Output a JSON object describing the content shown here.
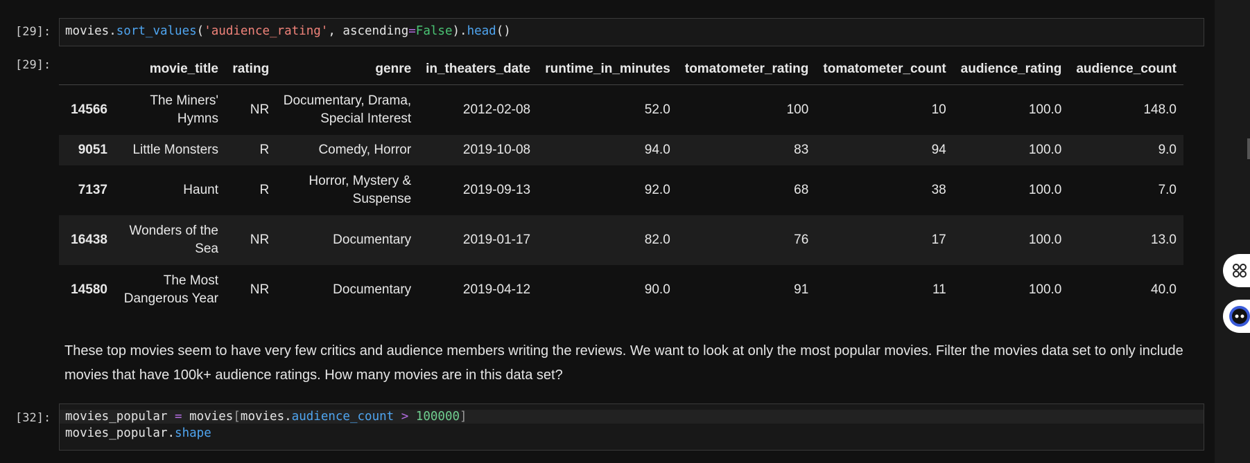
{
  "cells": {
    "c1": {
      "in_prompt": "[29]:",
      "out_prompt": "[29]:"
    },
    "c2": {
      "in_prompt": "[32]:"
    }
  },
  "code1": {
    "t1": "movies",
    "t2": ".",
    "t3": "sort_values",
    "t4": "(",
    "t5": "'audience_rating'",
    "t6": ", ascending",
    "t7": "=",
    "t8": "False",
    "t9": ").",
    "t10": "head",
    "t11": "()"
  },
  "code2": {
    "l1": {
      "t1": "movies_popular ",
      "t2": "=",
      "t3": " movies",
      "t4": "[",
      "t5": "movies.",
      "t6": "audience_count",
      "t7": " > ",
      "t8": "100000",
      "t9": "]"
    },
    "l2": {
      "t1": "movies_popular.",
      "t2": "shape"
    }
  },
  "table": {
    "columns": [
      "",
      "movie_title",
      "rating",
      "genre",
      "in_theaters_date",
      "runtime_in_minutes",
      "tomatometer_rating",
      "tomatometer_count",
      "audience_rating",
      "audience_count"
    ],
    "rows": [
      [
        "14566",
        "The Miners' Hymns",
        "NR",
        "Documentary, Drama, Special Interest",
        "2012-02-08",
        "52.0",
        "100",
        "10",
        "100.0",
        "148.0"
      ],
      [
        "9051",
        "Little Monsters",
        "R",
        "Comedy, Horror",
        "2019-10-08",
        "94.0",
        "83",
        "94",
        "100.0",
        "9.0"
      ],
      [
        "7137",
        "Haunt",
        "R",
        "Horror, Mystery & Suspense",
        "2019-09-13",
        "92.0",
        "68",
        "38",
        "100.0",
        "7.0"
      ],
      [
        "16438",
        "Wonders of the Sea",
        "NR",
        "Documentary",
        "2019-01-17",
        "82.0",
        "76",
        "17",
        "100.0",
        "13.0"
      ],
      [
        "14580",
        "The Most Dangerous Year",
        "NR",
        "Documentary",
        "2019-04-12",
        "90.0",
        "91",
        "11",
        "100.0",
        "40.0"
      ]
    ]
  },
  "markdown": {
    "text": "These top movies seem to have very few critics and audience members writing the reviews. We want to look at only the most popular movies. Filter the movies data set to only include movies that have 100k+ audience ratings. How many movies are in this data set?"
  },
  "colors": {
    "background": "#111111",
    "function": "#4fa5f0",
    "string": "#f0837a",
    "operator": "#b36ce0",
    "keyword": "#4ac474"
  }
}
